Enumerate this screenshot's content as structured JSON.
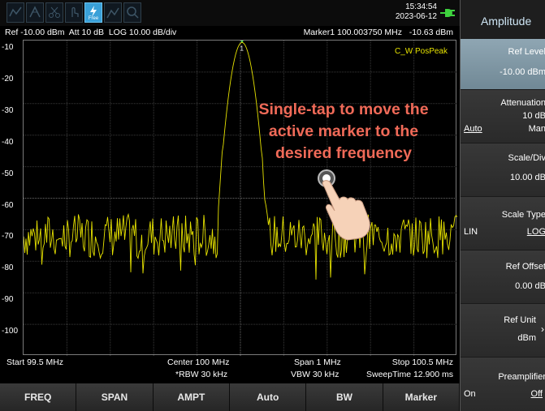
{
  "topbar": {
    "free_label": "Free",
    "time": "15:34:54",
    "date": "2023-06-12"
  },
  "info": {
    "left": "Ref -10.00 dBm  Att 10 dB  LOG 10.00 dB/div",
    "right": "Marker1 100.003750 MHz   -10.63 dBm"
  },
  "plot": {
    "y_labels": [
      "-10",
      "-20",
      "-30",
      "-40",
      "-50",
      "-60",
      "-70",
      "-80",
      "-90",
      "-100"
    ],
    "trace_label": "C_W PosPeak",
    "marker_number": "1",
    "trace_color": "#e6e200",
    "grid_color": "#3a3a3a"
  },
  "annotation": {
    "line1": "Single-tap to move the",
    "line2": "active marker to the",
    "line3": "desired frequency",
    "color": "#f06a58"
  },
  "bottom": {
    "start": "Start 99.5 MHz",
    "center": "Center 100 MHz",
    "rbw": "*RBW 30 kHz",
    "span": "Span 1 MHz",
    "vbw": "VBW 30 kHz",
    "stop": "Stop 100.5 MHz",
    "sweep": "SweepTime 12.900 ms"
  },
  "softkeys": [
    "FREQ",
    "SPAN",
    "AMPT",
    "Auto",
    "BW",
    "Marker"
  ],
  "menu": {
    "title": "Amplitude",
    "ref_level_label": "Ref Level",
    "ref_level_value": "-10.00 dBm",
    "attenuation_label": "Attenuation",
    "attenuation_value": "10 dB",
    "attenuation_auto": "Auto",
    "attenuation_man": "Man",
    "scale_div_label": "Scale/Div",
    "scale_div_value": "10.00 dB",
    "scale_type_label": "Scale Type",
    "scale_type_lin": "LIN",
    "scale_type_log": "LOG",
    "ref_offset_label": "Ref Offset",
    "ref_offset_value": "0.00 dB",
    "ref_unit_label": "Ref Unit",
    "ref_unit_value": "dBm",
    "preamp_label": "Preamplifier",
    "preamp_on": "On",
    "preamp_off": "Off"
  }
}
